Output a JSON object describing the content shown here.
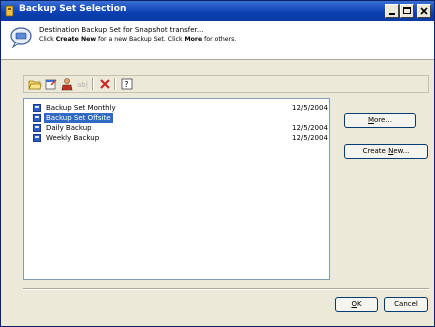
{
  "window": {
    "title": "Backup Set Selection"
  },
  "header": {
    "line1": "Destination Backup Set for Snapshot transfer...",
    "line2_pre": "Click ",
    "line2_bold1": "Create New",
    "line2_mid": " for a new Backup Set. Click ",
    "line2_bold2": "More",
    "line2_post": " for others."
  },
  "toolbar": {
    "icons": [
      "open-folder-icon",
      "properties-icon",
      "delete-user-icon",
      "rename-icon",
      "delete-icon",
      "help-icon"
    ]
  },
  "backup_sets": [
    {
      "name": "Backup Set Monthly",
      "date": "12/5/2004",
      "selected": false
    },
    {
      "name": "Backup Set Offsite",
      "date": "",
      "selected": true
    },
    {
      "name": "Daily Backup",
      "date": "12/5/2004",
      "selected": false
    },
    {
      "name": "Weekly Backup",
      "date": "12/5/2004",
      "selected": false
    }
  ],
  "buttons": {
    "more": {
      "pre": "",
      "u": "M",
      "post": "ore..."
    },
    "create_new": {
      "pre": "Create ",
      "u": "N",
      "post": "ew..."
    },
    "ok": {
      "pre": "",
      "u": "O",
      "post": "K"
    },
    "cancel": "Cancel"
  },
  "colors": {
    "title_bar": "#0a3fb0",
    "selection": "#316ac5",
    "window_bg": "#ece9d8"
  }
}
